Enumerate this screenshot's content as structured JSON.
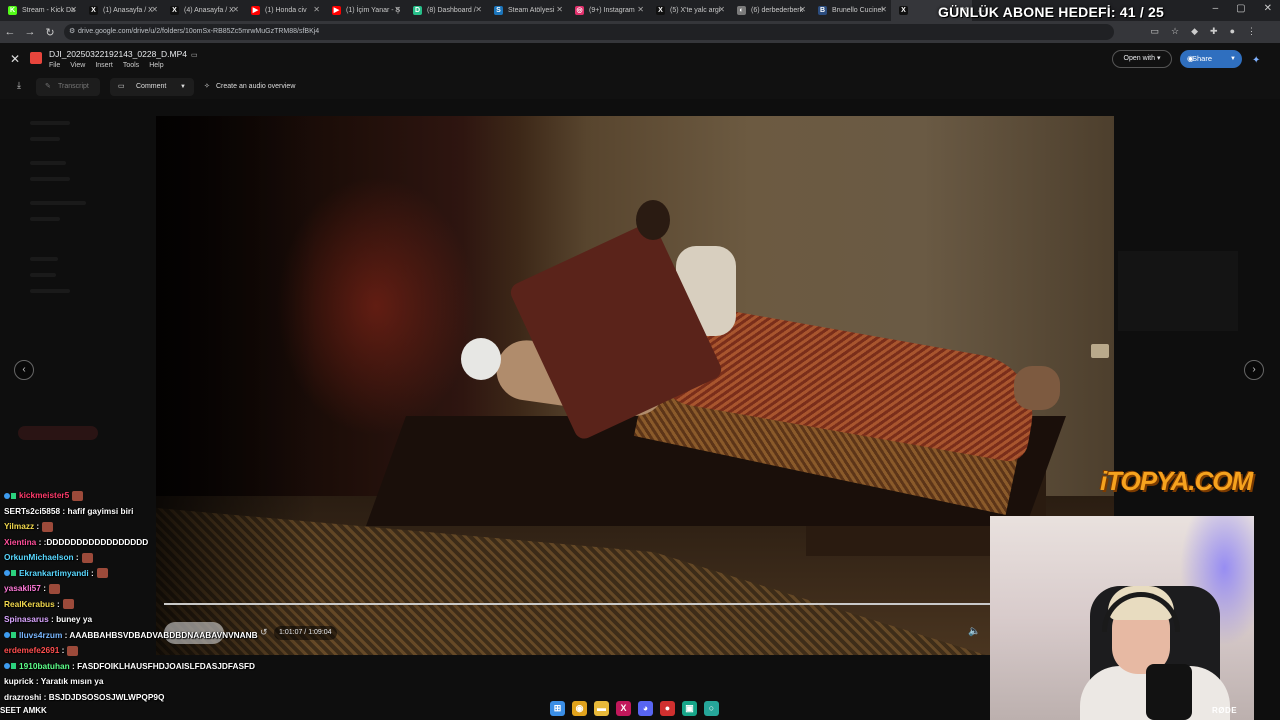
{
  "browser": {
    "tabs": [
      {
        "title": "Stream - Kick Da",
        "color": "#53fc18",
        "glyph": "K"
      },
      {
        "title": "(1) Anasayfa / X",
        "color": "#111111",
        "glyph": "X"
      },
      {
        "title": "(4) Anasayfa / X",
        "color": "#111111",
        "glyph": "X"
      },
      {
        "title": "(1) Honda civ",
        "color": "#ff0000",
        "glyph": "▶"
      },
      {
        "title": "(1) İçim Yanar - Ş",
        "color": "#ff0000",
        "glyph": "▶"
      },
      {
        "title": "(8) Dashboard /",
        "color": "#27c08a",
        "glyph": "D"
      },
      {
        "title": "Steam Atölyesi",
        "color": "#1b75bb",
        "glyph": "S"
      },
      {
        "title": "(9+) Instagram",
        "color": "#e1306c",
        "glyph": "◎"
      },
      {
        "title": "(5) X'te yalc argi",
        "color": "#111111",
        "glyph": "X"
      },
      {
        "title": "(6) derbederberk",
        "color": "#7a7a7a",
        "glyph": "◐"
      },
      {
        "title": "Brunello Cucinel",
        "color": "#2b4c7e",
        "glyph": "B"
      },
      {
        "title": "",
        "color": "#111111",
        "glyph": "X"
      }
    ],
    "url": "drive.google.com/drive/u/2/folders/10omSx-RB85Zc5mrwMuGzTRM88/sfBKj4"
  },
  "stream_goal": "GÜNLÜK ABONE HEDEFİ: 41 / 25",
  "viewer": {
    "file_name": "DJI_20250322192143_0228_D.MP4",
    "menus": [
      "File",
      "View",
      "Insert",
      "Tools",
      "Help"
    ],
    "open_with_label": "Open with",
    "share_label": "Share",
    "transcript_label": "Transcript",
    "comment_label": "Comment",
    "audio_overview_label": "Create an audio overview",
    "time_display": "1:01:07 / 1:09:04"
  },
  "sponsor_logo": "iTOPYA.COM",
  "chat": [
    {
      "user": "kickmeister5",
      "color": "#ff3b6b",
      "msg": "",
      "emote": true,
      "badges": true
    },
    {
      "user": "SERTs2ci5858",
      "color": "#ffffff",
      "msg": ": hafif gayimsi biri",
      "emote": false,
      "badges": false
    },
    {
      "user": "Yilmazz",
      "color": "#f2d94e",
      "msg": ":",
      "emote": true,
      "badges": false
    },
    {
      "user": "Xientina",
      "color": "#ff4f9a",
      "msg": ": :DDDDDDDDDDDDDDDDD",
      "emote": false,
      "badges": false
    },
    {
      "user": "OrkunMichaelson",
      "color": "#59d8ff",
      "msg": ":",
      "emote": true,
      "badges": false
    },
    {
      "user": "Ekrankartimyandi",
      "color": "#59d8ff",
      "msg": ":",
      "emote": true,
      "badges": true
    },
    {
      "user": "yasakli57",
      "color": "#ff7ad9",
      "msg": ":",
      "emote": true,
      "badges": false
    },
    {
      "user": "RealKerabus",
      "color": "#f2d94e",
      "msg": ":",
      "emote": true,
      "badges": false
    },
    {
      "user": "Spinasarus",
      "color": "#d9a5ff",
      "msg": ": buney ya",
      "emote": false,
      "badges": false
    },
    {
      "user": "lluvs4rzum",
      "color": "#7ab8ff",
      "msg": ": AAABBAHBSVDBADVABDBDNAABAVNVNANB",
      "emote": false,
      "badges": true
    },
    {
      "user": "erdemefe2691",
      "color": "#ff4f4f",
      "msg": ":",
      "emote": true,
      "badges": false
    },
    {
      "user": "1910batuhan",
      "color": "#5dff8a",
      "msg": ": FASDFOIKLHAUSFHDJOAISLFDASJDFASFD",
      "emote": false,
      "badges": true
    },
    {
      "user": "kuprick",
      "color": "#ffffff",
      "msg": ": Yaratık mısın ya",
      "emote": false,
      "badges": false
    },
    {
      "user": "drazroshi",
      "color": "#ffffff",
      "msg": ": BSJDJDSOSOSJWLWPQP9Q",
      "emote": false,
      "badges": false
    }
  ],
  "bottom_ticker": "SEET AMKK",
  "webcam": {
    "mic_brand": "RØDE"
  },
  "taskbar": [
    {
      "name": "windows-start-icon",
      "glyph": "⊞",
      "color": "#3a8ee6"
    },
    {
      "name": "chrome-icon",
      "glyph": "◉",
      "color": "#e0a21c"
    },
    {
      "name": "file-explorer-icon",
      "glyph": "▬",
      "color": "#e8b93a"
    },
    {
      "name": "x-app-icon",
      "glyph": "X",
      "color": "#c2185b"
    },
    {
      "name": "discord-icon",
      "glyph": "◕",
      "color": "#5865f2"
    },
    {
      "name": "obs-icon",
      "glyph": "●",
      "color": "#d0302f"
    },
    {
      "name": "cursor-app-icon",
      "glyph": "▣",
      "color": "#17a589"
    },
    {
      "name": "search-app-icon",
      "glyph": "○",
      "color": "#26a69a"
    }
  ]
}
